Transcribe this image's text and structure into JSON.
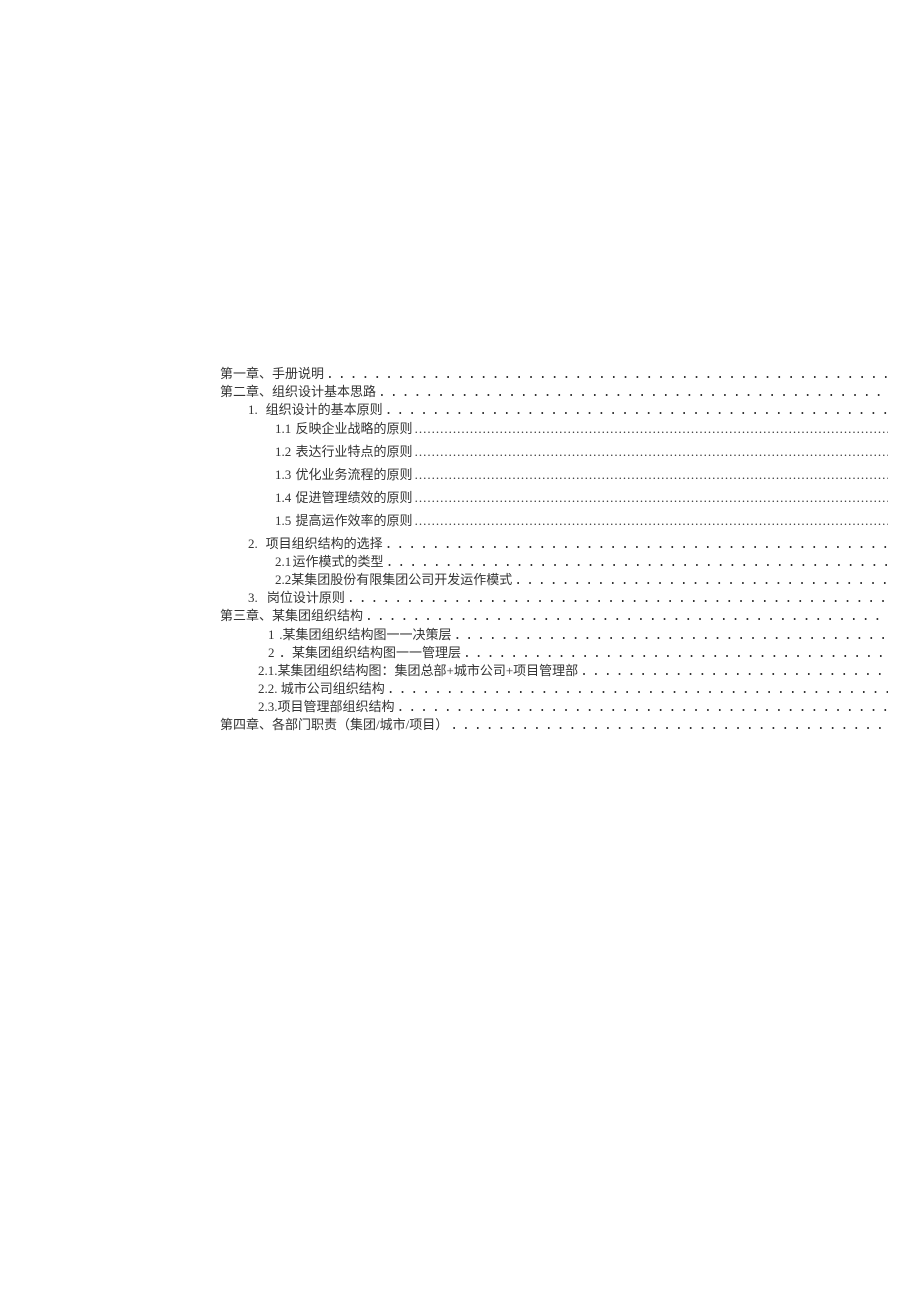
{
  "dots_spaced": "............................................................................................",
  "dots_dense": "..............................................................................................................................................................................................................",
  "toc": [
    {
      "indent": "l0",
      "style": "row",
      "dots": "spaced",
      "text": "第一章、手册说明"
    },
    {
      "indent": "l0",
      "style": "row",
      "dots": "spaced",
      "text": "第二章、组织设计基本思路"
    },
    {
      "indent": "l1",
      "style": "row",
      "dots": "spaced",
      "num": "1.",
      "numw": "w2",
      "text": "组织设计的基本原则"
    },
    {
      "indent": "l2",
      "style": "row tall",
      "dots": "dense",
      "num": "1.1",
      "numw": "w2",
      "text": "反映企业战略的原则"
    },
    {
      "indent": "l2",
      "style": "row tall",
      "dots": "dense",
      "num": "1.2",
      "numw": "w2",
      "text": "表达行业特点的原则"
    },
    {
      "indent": "l2",
      "style": "row tall",
      "dots": "dense",
      "num": "1.3",
      "numw": "w2",
      "text": "优化业务流程的原则"
    },
    {
      "indent": "l2",
      "style": "row tall",
      "dots": "dense",
      "num": "1.4",
      "numw": "w2",
      "text": "促进管理绩效的原则"
    },
    {
      "indent": "l2",
      "style": "row tall",
      "dots": "dense",
      "num": "1.5",
      "numw": "w2",
      "text": "提高运作效率的原则"
    },
    {
      "indent": "l1",
      "style": "row",
      "dots": "spaced",
      "num": "2.",
      "numw": "w2",
      "text": "项目组织结构的选择"
    },
    {
      "indent": "l2",
      "style": "row",
      "dots": "spaced",
      "num": "2.1",
      "numw": "w2",
      "text": "运作模式的类型"
    },
    {
      "indent": "l2",
      "style": "row",
      "dots": "spaced",
      "num": "2.2",
      "numw": "w2",
      "text": "某集团股份有限集团公司开发运作模式"
    },
    {
      "indent": "l1",
      "style": "row",
      "dots": "spaced",
      "num": "3.",
      "numw": "w2",
      "text": "岗位设计原则"
    },
    {
      "indent": "l0",
      "style": "row",
      "dots": "spaced",
      "text": "第三章、某集团组织结构"
    },
    {
      "indent": "l2b",
      "style": "row",
      "dots": "spaced",
      "num": "1",
      "numw": "w1",
      "text": ".某集团组织结构图一一决策层"
    },
    {
      "indent": "l2b",
      "style": "row",
      "dots": "spaced",
      "num": "2",
      "numw": "w1",
      "text": "．某集团组织结构图一一管理层"
    },
    {
      "indent": "l2c",
      "style": "row",
      "dots": "spaced",
      "text": "2.1.某集团组织结构图：集团总部+城市公司+项目管理部"
    },
    {
      "indent": "l2c",
      "style": "row",
      "dots": "spaced",
      "text": "2.2. 城市公司组织结构"
    },
    {
      "indent": "l2c",
      "style": "row",
      "dots": "spaced",
      "text": "2.3.项目管理部组织结构"
    },
    {
      "indent": "l0",
      "style": "row",
      "dots": "spaced",
      "text": "第四章、各部门职责（集团/城市/项目）"
    }
  ]
}
